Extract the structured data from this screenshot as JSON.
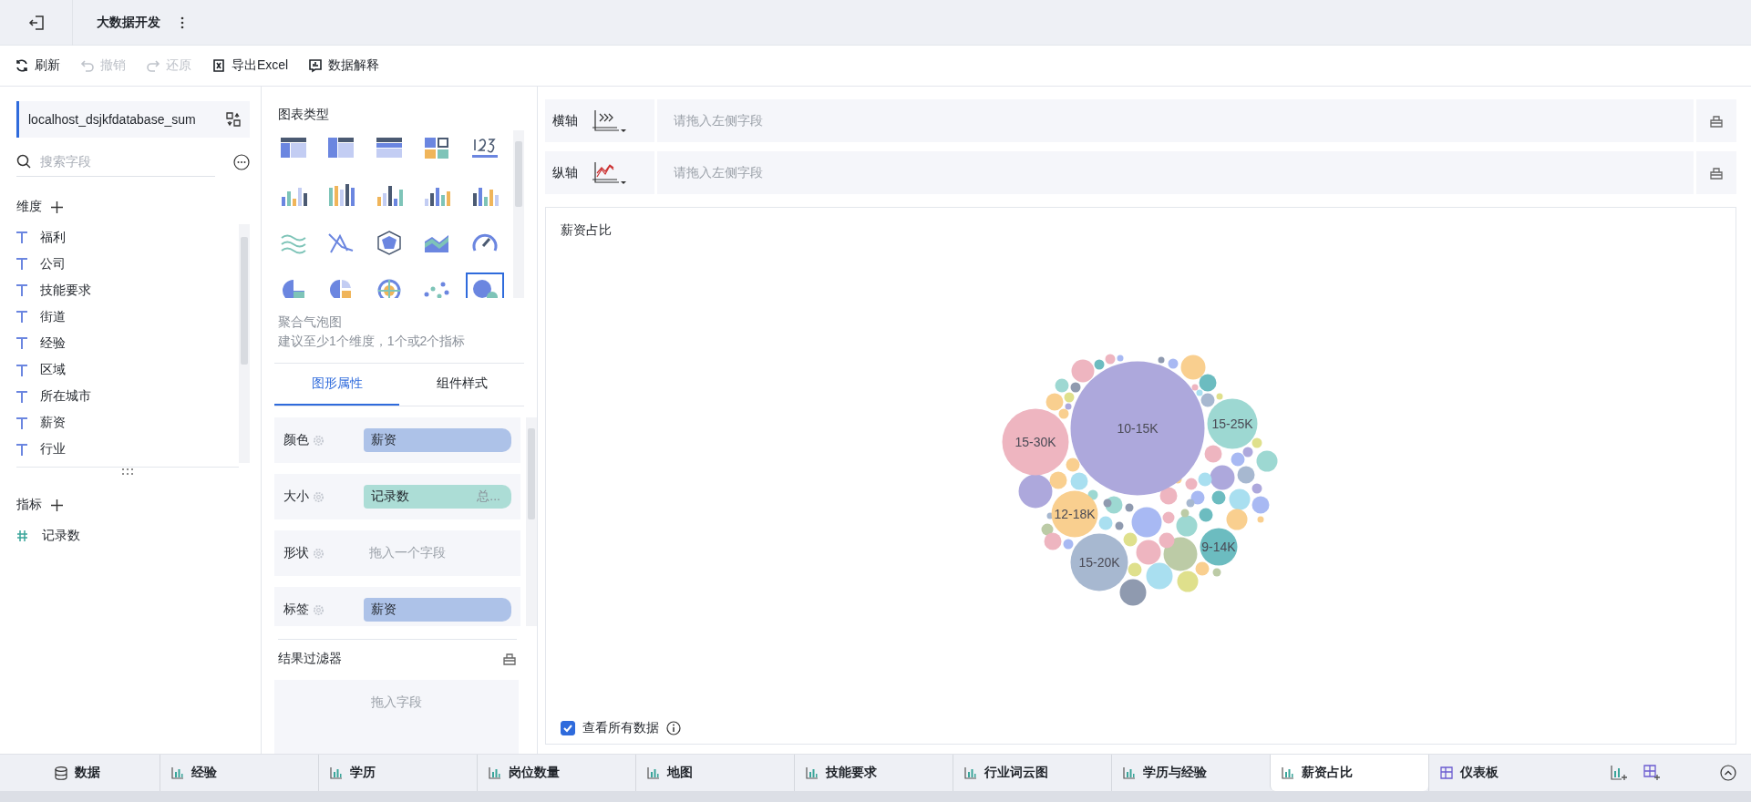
{
  "app_bar": {
    "title": "大数据开发"
  },
  "toolbar": [
    {
      "label": "刷新",
      "kind": "refresh",
      "disabled": false
    },
    {
      "label": "撤销",
      "kind": "undo",
      "disabled": true
    },
    {
      "label": "还原",
      "kind": "redo",
      "disabled": true
    },
    {
      "label": "导出Excel",
      "kind": "excel",
      "disabled": false
    },
    {
      "label": "数据解释",
      "kind": "explain",
      "disabled": false
    }
  ],
  "data_panel": {
    "source": "localhost_dsjkfdatabase_sum",
    "search": {
      "placeholder": "搜索字段"
    },
    "dimensions": {
      "title": "维度",
      "fields": [
        "福利",
        "公司",
        "技能要求",
        "街道",
        "经验",
        "区域",
        "所在城市",
        "薪资",
        "行业"
      ]
    },
    "measures": {
      "title": "指标",
      "fields": [
        "记录数"
      ]
    }
  },
  "chart_panel": {
    "title": "图表类型",
    "chart_types": [
      {
        "selected": false
      },
      {
        "selected": false
      },
      {
        "selected": false
      },
      {
        "selected": false
      },
      {
        "selected": false
      },
      {
        "selected": false
      },
      {
        "selected": false
      },
      {
        "selected": false
      },
      {
        "selected": false
      },
      {
        "selected": false
      },
      {
        "selected": false
      },
      {
        "selected": false
      },
      {
        "selected": false
      },
      {
        "selected": false
      },
      {
        "selected": false
      },
      {
        "selected": false
      },
      {
        "selected": false
      },
      {
        "selected": false
      },
      {
        "selected": false
      },
      {
        "selected": true
      }
    ],
    "chart_name": "聚合气泡图",
    "hint": "建议至少1个维度，1个或2个指标",
    "tabs": [
      {
        "label": "图形属性",
        "selected": true
      },
      {
        "label": "组件样式",
        "selected": false
      }
    ],
    "properties": [
      {
        "label": "颜色",
        "field": {
          "text": "薪资",
          "kind": "dimension"
        }
      },
      {
        "label": "大小",
        "field": {
          "text": "记录数",
          "aggregate": "总...",
          "kind": "measure"
        }
      },
      {
        "label": "形状",
        "placeholder": "拖入一个字段"
      },
      {
        "label": "标签",
        "field": {
          "text": "薪资",
          "kind": "dimension"
        }
      }
    ],
    "filter": {
      "title": "结果过滤器",
      "placeholder": "拖入字段"
    }
  },
  "axes": [
    {
      "label": "横轴",
      "kind": "x",
      "placeholder": "请拖入左侧字段"
    },
    {
      "label": "纵轴",
      "kind": "y",
      "placeholder": "请拖入左侧字段"
    }
  ],
  "chart": {
    "title": "薪资占比",
    "bubble_labels": [
      "10-15K",
      "15-30K",
      "15-25K",
      "12-18K",
      "15-20K",
      "9-14K"
    ],
    "show_all": {
      "label": "查看所有数据",
      "checked": true
    }
  },
  "sheet_tabs": [
    {
      "label": "数据",
      "kind": "data",
      "selected": false
    },
    {
      "label": "经验",
      "kind": "chart",
      "selected": false
    },
    {
      "label": "学历",
      "kind": "chart",
      "selected": false
    },
    {
      "label": "岗位数量",
      "kind": "chart",
      "selected": false
    },
    {
      "label": "地图",
      "kind": "chart",
      "selected": false
    },
    {
      "label": "技能要求",
      "kind": "chart",
      "selected": false
    },
    {
      "label": "行业词云图",
      "kind": "chart",
      "selected": false
    },
    {
      "label": "学历与经验",
      "kind": "chart",
      "selected": false
    },
    {
      "label": "薪资占比",
      "kind": "chart",
      "selected": true
    },
    {
      "label": "仪表板",
      "kind": "dashboard",
      "selected": false
    }
  ]
}
